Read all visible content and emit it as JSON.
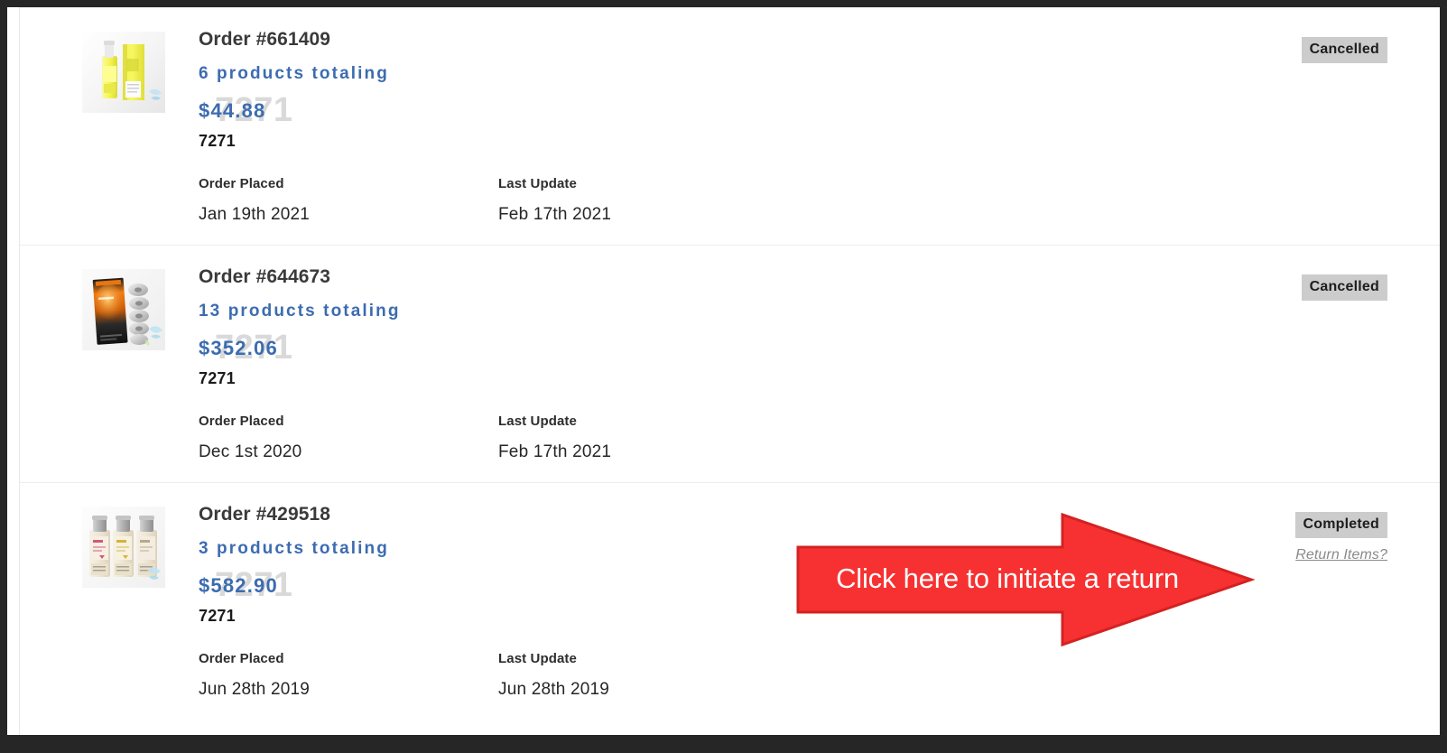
{
  "page": {
    "background": "#ffffff",
    "frame_color": "#262626",
    "divider_color": "#ededed"
  },
  "colors": {
    "accent_blue": "#3c6cb0",
    "watermark_gray": "#d9d9d9",
    "badge_bg": "#cccccc",
    "badge_text": "#1d1d1d",
    "link_gray": "#8a8a8a",
    "callout_red": "#f73131",
    "callout_red_stroke": "#d42222",
    "title_gray": "#3a3a3a"
  },
  "labels": {
    "order_placed": "Order Placed",
    "last_update": "Last Update"
  },
  "orders": [
    {
      "title": "Order #661409",
      "products_line": "6 products totaling",
      "price": "$44.88",
      "watermark": "7271",
      "code": "7271",
      "order_placed": "Jan 19th 2021",
      "last_update": "Feb 17th 2021",
      "status": "Cancelled",
      "return_link": null,
      "thumb": "yellow-eliquid-bottle-and-box"
    },
    {
      "title": "Order #644673",
      "products_line": "13 products totaling",
      "price": "$352.06",
      "watermark": "7271",
      "code": "7271",
      "order_placed": "Dec 1st 2020",
      "last_update": "Feb 17th 2021",
      "status": "Cancelled",
      "return_link": null,
      "thumb": "orange-black-coil-pack"
    },
    {
      "title": "Order #429518",
      "products_line": "3 products totaling",
      "price": "$582.90",
      "watermark": "7271",
      "code": "7271",
      "order_placed": "Jun 28th 2019",
      "last_update": "Jun 28th 2019",
      "status": "Completed",
      "return_link": "Return Items?",
      "thumb": "three-cream-bottles"
    }
  ],
  "callout": {
    "text": "Click here to initiate a return",
    "direction": "right",
    "fill": "#f73131",
    "stroke": "#d42222"
  }
}
